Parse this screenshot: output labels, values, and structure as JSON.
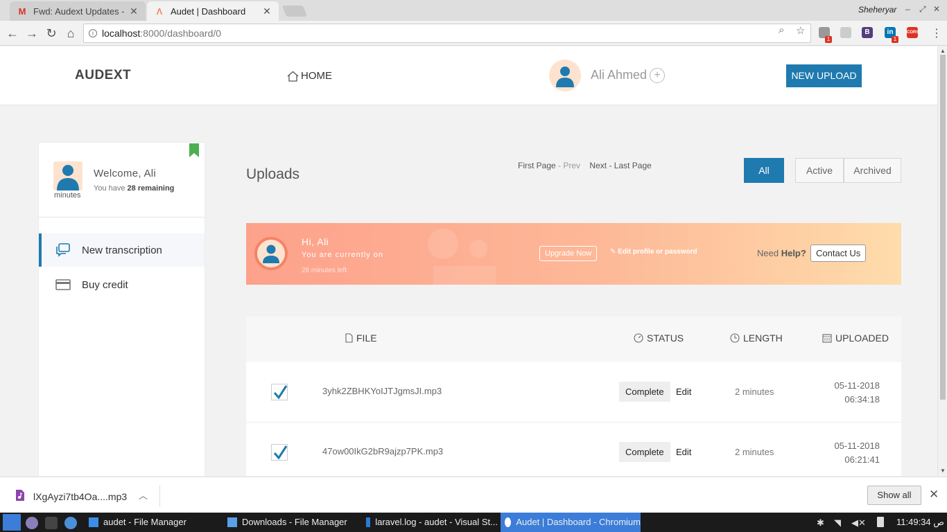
{
  "browser": {
    "tabs": [
      {
        "title": "Fwd: Audext Updates - ",
        "icon": "gmail-icon"
      },
      {
        "title": "Audet | Dashboard",
        "icon": "audet-icon"
      }
    ],
    "profile_name": "Sheheryar",
    "url_host": "localhost",
    "url_rest": ":8000/dashboard/0",
    "extensions": [
      "adblock-icon",
      "dev-icon",
      "bootstrap-icon",
      "linkedin-icon",
      "cors-icon"
    ],
    "ext_labels": {
      "bootstrap": "B",
      "linkedin": "in",
      "cors": "CORS",
      "badge": "1"
    }
  },
  "navbar": {
    "brand": "AUDEXT",
    "home": "HOME",
    "user": "Ali Ahmed",
    "plus": "+",
    "new_upload": "NEW UPLOAD"
  },
  "sidebar": {
    "welcome": "Welcome, Ali",
    "remaining_prefix": "You have",
    "remaining_value": "28 remaining",
    "minutes_label": "minutes",
    "items": [
      {
        "label": "New transcription",
        "icon": "chat-icon"
      },
      {
        "label": "Buy credit",
        "icon": "credit-card-icon"
      }
    ]
  },
  "uploads": {
    "title": "Uploads",
    "pager": {
      "first": "First Page",
      "sep": "-",
      "prev": "Prev",
      "next": "Next",
      "last": "Last Page"
    },
    "filters": [
      "All",
      "Active",
      "Archived"
    ]
  },
  "banner": {
    "greeting": "Hi, Ali",
    "line1": "You are currently on",
    "line2": "28 minutes left",
    "upgrade": "Upgrade Now",
    "edit_profile": "Edit profile or password",
    "need": "Need",
    "help": "Help?",
    "contact": "Contact Us"
  },
  "table": {
    "headers": {
      "file": "FILE",
      "status": "STATUS",
      "length": "LENGTH",
      "uploaded": "UPLOADED"
    },
    "rows": [
      {
        "file": "3yhk2ZBHKYoIJTJgmsJI.mp3",
        "status": "Complete",
        "edit": "Edit",
        "length": "2 minutes",
        "date": "05-11-2018",
        "time": "06:34:18"
      },
      {
        "file": "47ow00IkG2bR9ajzp7PK.mp3",
        "status": "Complete",
        "edit": "Edit",
        "length": "2 minutes",
        "date": "05-11-2018",
        "time": "06:21:41"
      }
    ]
  },
  "downloads": {
    "file": "lXgAyzi7tb4Oa....mp3",
    "show_all": "Show all"
  },
  "taskbar": {
    "items": [
      {
        "label": "audet - File Manager"
      },
      {
        "label": "Downloads - File Manager"
      },
      {
        "label": "laravel.log - audet - Visual St..."
      },
      {
        "label": "Audet | Dashboard - Chromium"
      }
    ],
    "clock": "11:49:34 ص"
  },
  "colors": {
    "accent": "#1f7aaf",
    "banner_start": "#fda18b",
    "banner_end": "#fedcab",
    "bookmark": "#4caf50"
  }
}
